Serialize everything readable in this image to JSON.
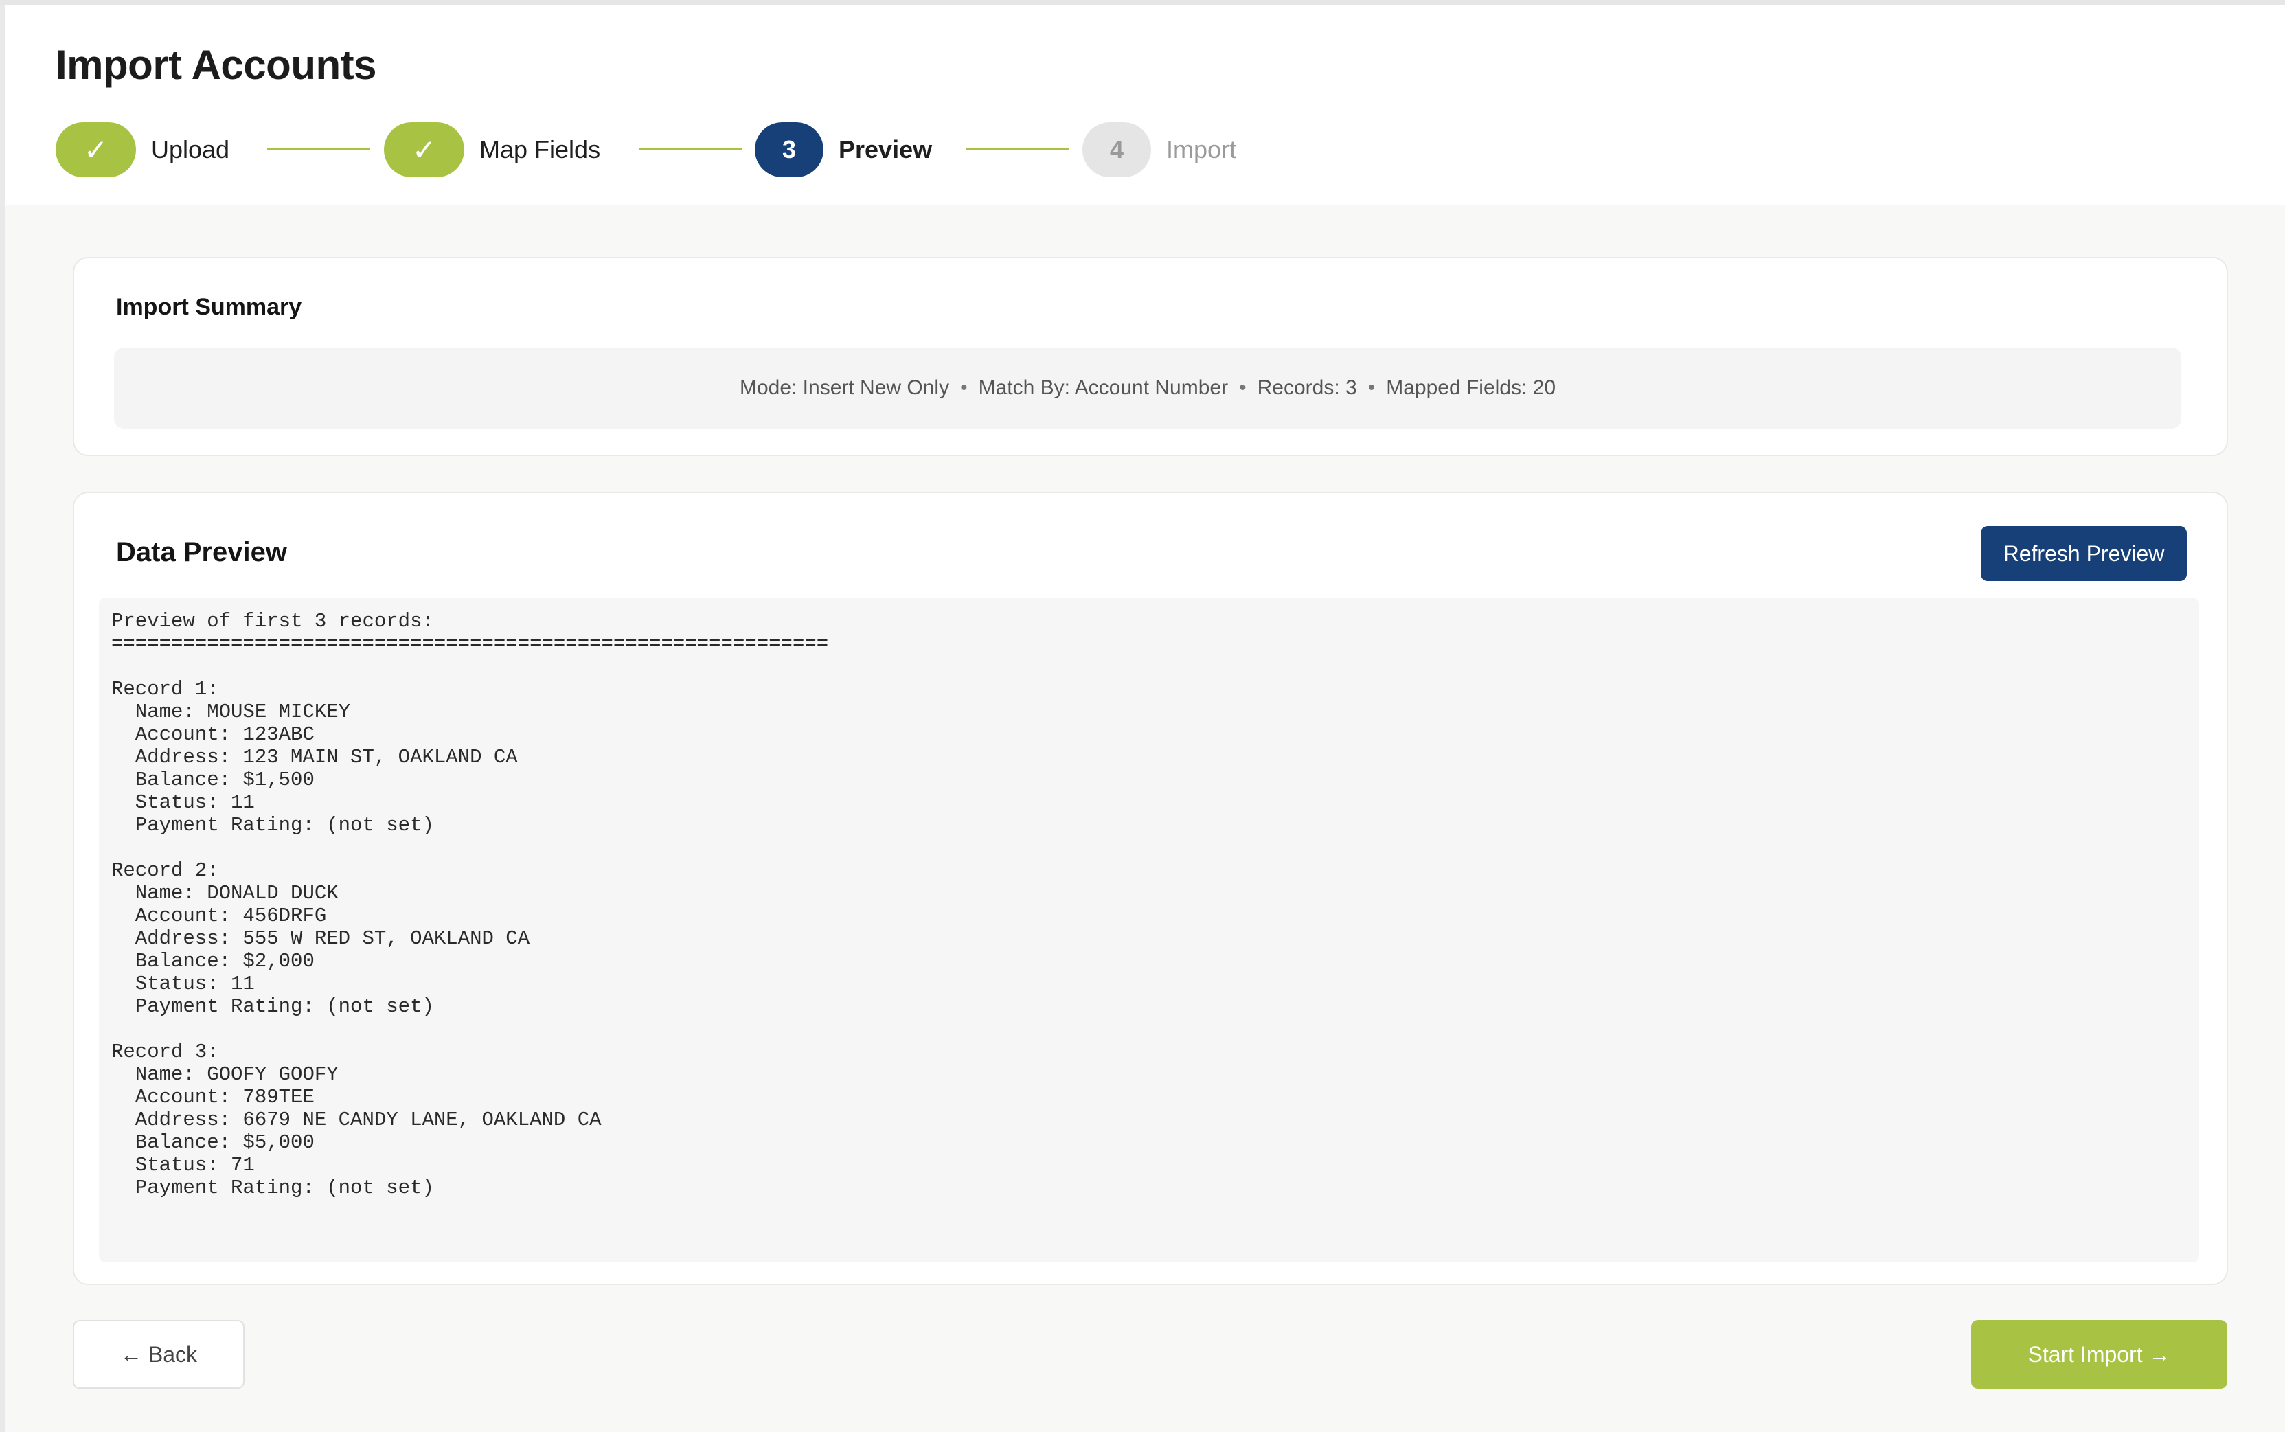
{
  "page": {
    "title": "Import Accounts"
  },
  "stepper": {
    "steps": [
      {
        "marker": "✓",
        "label": "Upload",
        "state": "done"
      },
      {
        "marker": "✓",
        "label": "Map Fields",
        "state": "done"
      },
      {
        "marker": "3",
        "label": "Preview",
        "state": "active"
      },
      {
        "marker": "4",
        "label": "Import",
        "state": "pending"
      }
    ]
  },
  "summary": {
    "title": "Import Summary",
    "mode": "Mode: Insert New Only",
    "match_by": "Match By: Account Number",
    "records": "Records: 3",
    "mapped_fields": "Mapped Fields: 20",
    "separator": "•"
  },
  "preview": {
    "title": "Data Preview",
    "refresh_label": "Refresh Preview",
    "text": "Preview of first 3 records:\n============================================================\n\nRecord 1:\n  Name: MOUSE MICKEY\n  Account: 123ABC\n  Address: 123 MAIN ST, OAKLAND CA\n  Balance: $1,500\n  Status: 11\n  Payment Rating: (not set)\n\nRecord 2:\n  Name: DONALD DUCK\n  Account: 456DRFG\n  Address: 555 W RED ST, OAKLAND CA\n  Balance: $2,000\n  Status: 11\n  Payment Rating: (not set)\n\nRecord 3:\n  Name: GOOFY GOOFY\n  Account: 789TEE\n  Address: 6679 NE CANDY LANE, OAKLAND CA\n  Balance: $5,000\n  Status: 71\n  Payment Rating: (not set)"
  },
  "footer": {
    "back_label": "← Back",
    "start_label": "Start Import →"
  },
  "colors": {
    "accent_green": "#a8c343",
    "primary_navy": "#173f78",
    "pending_gray": "#e5e5e5"
  }
}
